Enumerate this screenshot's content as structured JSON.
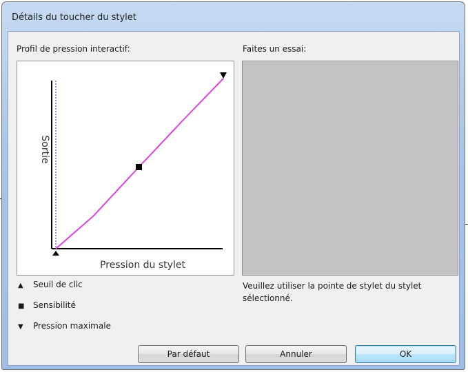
{
  "window": {
    "title": "Détails du toucher du stylet"
  },
  "profile": {
    "label": "Profil de pression interactif:",
    "y_axis_label": "Sortie",
    "x_axis_label": "Pression du stylet"
  },
  "test_area": {
    "label": "Faites un essai:",
    "hint": "Veuillez utiliser la pointe de stylet du stylet sélectionné."
  },
  "legend": [
    {
      "symbol": "▲",
      "icon": "triangle-up-icon",
      "label": "Seuil de clic"
    },
    {
      "symbol": "■",
      "icon": "square-icon",
      "label": "Sensibilité"
    },
    {
      "symbol": "▼",
      "icon": "triangle-down-icon",
      "label": "Pression maximale"
    }
  ],
  "buttons": {
    "default": "Par défaut",
    "cancel": "Annuler",
    "ok": "OK"
  },
  "colors": {
    "curve": "#e040e0",
    "threshold_line": "#3a3ad0",
    "test_area_bg": "#c4c4c4"
  }
}
